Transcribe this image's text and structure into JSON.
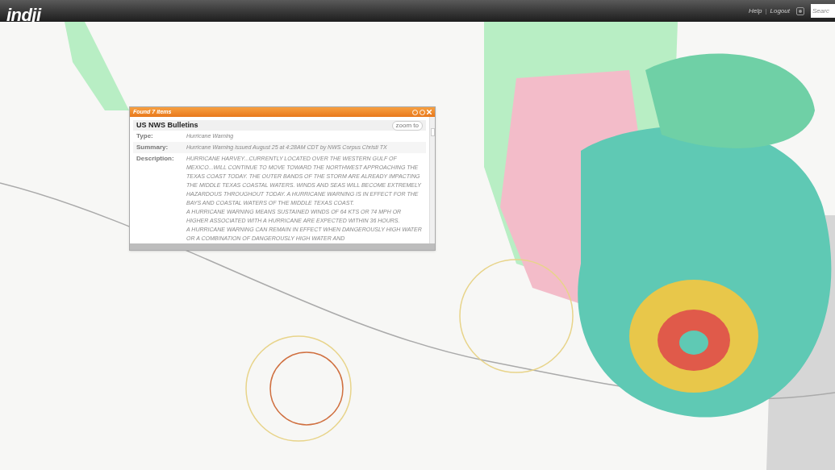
{
  "header": {
    "logo": "indji",
    "links": [
      "Help",
      "Logout"
    ],
    "link_separator": "|",
    "search": {
      "placeholder": "Searc"
    }
  },
  "popup": {
    "title": "Found 7 items",
    "heading": "US NWS Bulletins",
    "zoom_button": "zoom to",
    "fields": [
      {
        "label": "Type:",
        "value": [
          "Hurricane Warning"
        ]
      },
      {
        "label": "Summary:",
        "value": [
          "Hurricane Warning issued August 25 at 4:28AM CDT by NWS Corpus Christi TX"
        ]
      },
      {
        "label": "Description:",
        "value": [
          "HURRICANE HARVEY...CURRENTLY LOCATED OVER THE WESTERN GULF OF MEXICO...WILL CONTINUE TO MOVE TOWARD THE NORTHWEST APPROACHING THE TEXAS COAST TODAY. THE OUTER BANDS OF THE STORM ARE ALREADY IMPACTING THE MIDDLE TEXAS COASTAL WATERS. WINDS AND SEAS WILL BECOME EXTREMELY HAZARDOUS THROUGHOUT TODAY.  A HURRICANE WARNING IS IN EFFECT FOR THE BAYS AND COASTAL WATERS OF THE MIDDLE TEXAS COAST.",
          "A HURRICANE WARNING MEANS SUSTAINED WINDS OF 64 KTS OR 74 MPH OR HIGHER ASSOCIATED WITH A HURRICANE ARE EXPECTED WITHIN 36 HOURS.",
          "A HURRICANE WARNING CAN REMAIN IN EFFECT WHEN DANGEROUSLY HIGH WATER OR A COMBINATION OF DANGEROUSLY HIGH WATER AND"
        ]
      }
    ]
  }
}
